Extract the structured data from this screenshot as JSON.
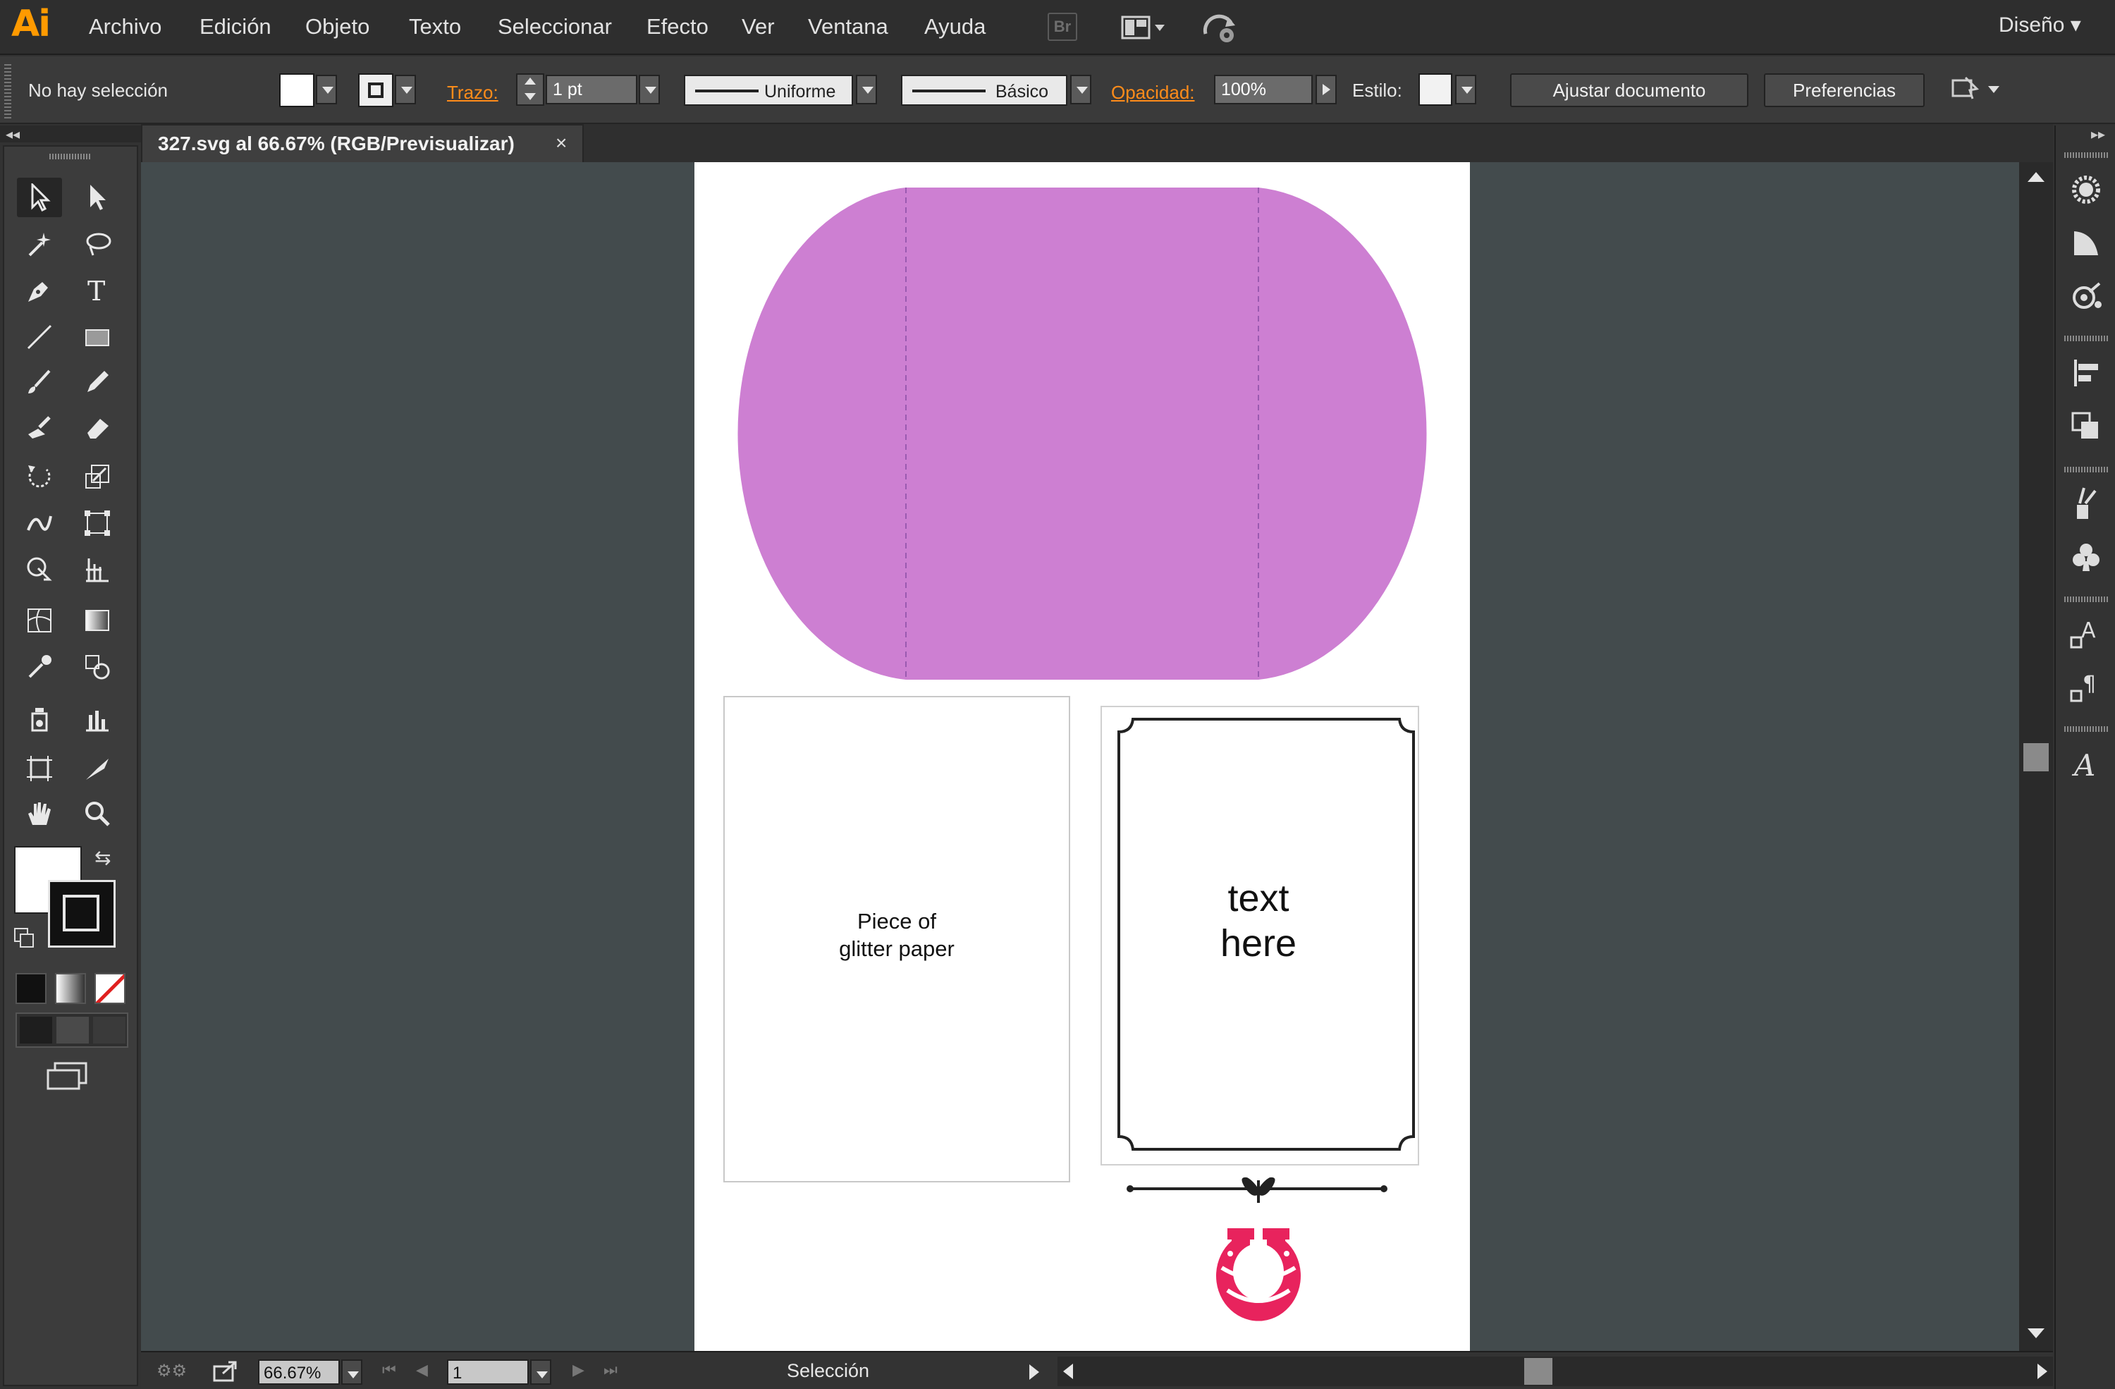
{
  "app": {
    "logo": "Ai",
    "menu": [
      "Archivo",
      "Edición",
      "Objeto",
      "Texto",
      "Seleccionar",
      "Efecto",
      "Ver",
      "Ventana",
      "Ayuda"
    ],
    "bridge_label": "Br",
    "workspace": "Diseño ▾"
  },
  "control_bar": {
    "selection_status": "No hay selección",
    "stroke_label": "Trazo:",
    "stroke_weight": "1 pt",
    "variable_width": "Uniforme",
    "brush": "Básico",
    "opacity_label": "Opacidad:",
    "opacity_value": "100%",
    "style_label": "Estilo:",
    "fit_document_button": "Ajustar documento",
    "preferences_button": "Preferencias"
  },
  "document_tab": {
    "title": "327.svg al 66.67% (RGB/Previsualizar)",
    "close": "×"
  },
  "artwork": {
    "envelope_color": "#cd7fd2",
    "glitter_text_line1": "Piece of",
    "glitter_text_line2": "glitter paper",
    "frame_text_line1": "text",
    "frame_text_line2": "here",
    "horseshoe_color": "#e8235d"
  },
  "status_bar": {
    "zoom": "66.67%",
    "artboard_number": "1",
    "tool_status": "Selección"
  },
  "colors": {
    "accent_orange": "#ff8c1a",
    "canvas": "#434b4d"
  }
}
